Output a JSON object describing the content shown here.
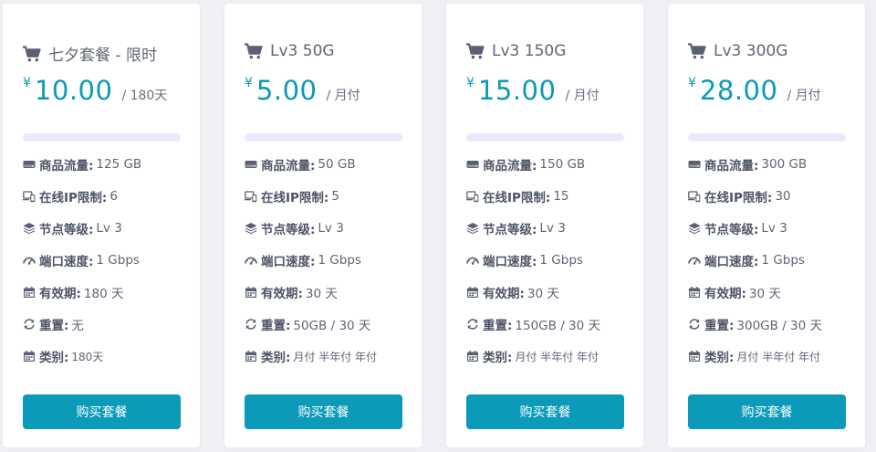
{
  "plans": [
    {
      "title": "七夕套餐 - 限时",
      "currency": "¥",
      "price": "10.00",
      "period": "/ 180天",
      "features": {
        "traffic": {
          "label": "商品流量:",
          "value": "125 GB"
        },
        "ip_limit": {
          "label": "在线IP限制:",
          "value": "6"
        },
        "level": {
          "label": "节点等级:",
          "value": "Lv 3"
        },
        "speed": {
          "label": "端口速度:",
          "value": "1 Gbps"
        },
        "validity": {
          "label": "有效期:",
          "value": "180 天"
        },
        "reset": {
          "label": "重置:",
          "value": "无"
        },
        "category": {
          "label": "类别:",
          "value": "180天"
        }
      },
      "buy_label": "购买套餐"
    },
    {
      "title": "Lv3 50G",
      "currency": "¥",
      "price": "5.00",
      "period": "/ 月付",
      "features": {
        "traffic": {
          "label": "商品流量:",
          "value": "50 GB"
        },
        "ip_limit": {
          "label": "在线IP限制:",
          "value": "5"
        },
        "level": {
          "label": "节点等级:",
          "value": "Lv 3"
        },
        "speed": {
          "label": "端口速度:",
          "value": "1 Gbps"
        },
        "validity": {
          "label": "有效期:",
          "value": "30 天"
        },
        "reset": {
          "label": "重置:",
          "value": "50GB / 30 天"
        },
        "category": {
          "label": "类别:",
          "value": "月付 半年付 年付"
        }
      },
      "buy_label": "购买套餐"
    },
    {
      "title": "Lv3 150G",
      "currency": "¥",
      "price": "15.00",
      "period": "/ 月付",
      "features": {
        "traffic": {
          "label": "商品流量:",
          "value": "150 GB"
        },
        "ip_limit": {
          "label": "在线IP限制:",
          "value": "15"
        },
        "level": {
          "label": "节点等级:",
          "value": "Lv 3"
        },
        "speed": {
          "label": "端口速度:",
          "value": "1 Gbps"
        },
        "validity": {
          "label": "有效期:",
          "value": "30 天"
        },
        "reset": {
          "label": "重置:",
          "value": "150GB / 30 天"
        },
        "category": {
          "label": "类别:",
          "value": "月付 半年付 年付"
        }
      },
      "buy_label": "购买套餐"
    },
    {
      "title": "Lv3 300G",
      "currency": "¥",
      "price": "28.00",
      "period": "/ 月付",
      "features": {
        "traffic": {
          "label": "商品流量:",
          "value": "300 GB"
        },
        "ip_limit": {
          "label": "在线IP限制:",
          "value": "30"
        },
        "level": {
          "label": "节点等级:",
          "value": "Lv 3"
        },
        "speed": {
          "label": "端口速度:",
          "value": "1 Gbps"
        },
        "validity": {
          "label": "有效期:",
          "value": "30 天"
        },
        "reset": {
          "label": "重置:",
          "value": "300GB / 30 天"
        },
        "category": {
          "label": "类别:",
          "value": "月付 半年付 年付"
        }
      },
      "buy_label": "购买套餐"
    }
  ],
  "icons": {
    "title": "cart-icon",
    "traffic": "hard-drive-icon",
    "ip_limit": "devices-icon",
    "level": "layers-icon",
    "speed": "speedometer-icon",
    "validity": "calendar-icon",
    "reset": "sync-icon",
    "category": "calendar-icon"
  },
  "colors": {
    "accent": "#0b9ab8",
    "progress_track": "#ece9ff",
    "page_background": "#f0f0f4",
    "icon": "#5a6072"
  }
}
